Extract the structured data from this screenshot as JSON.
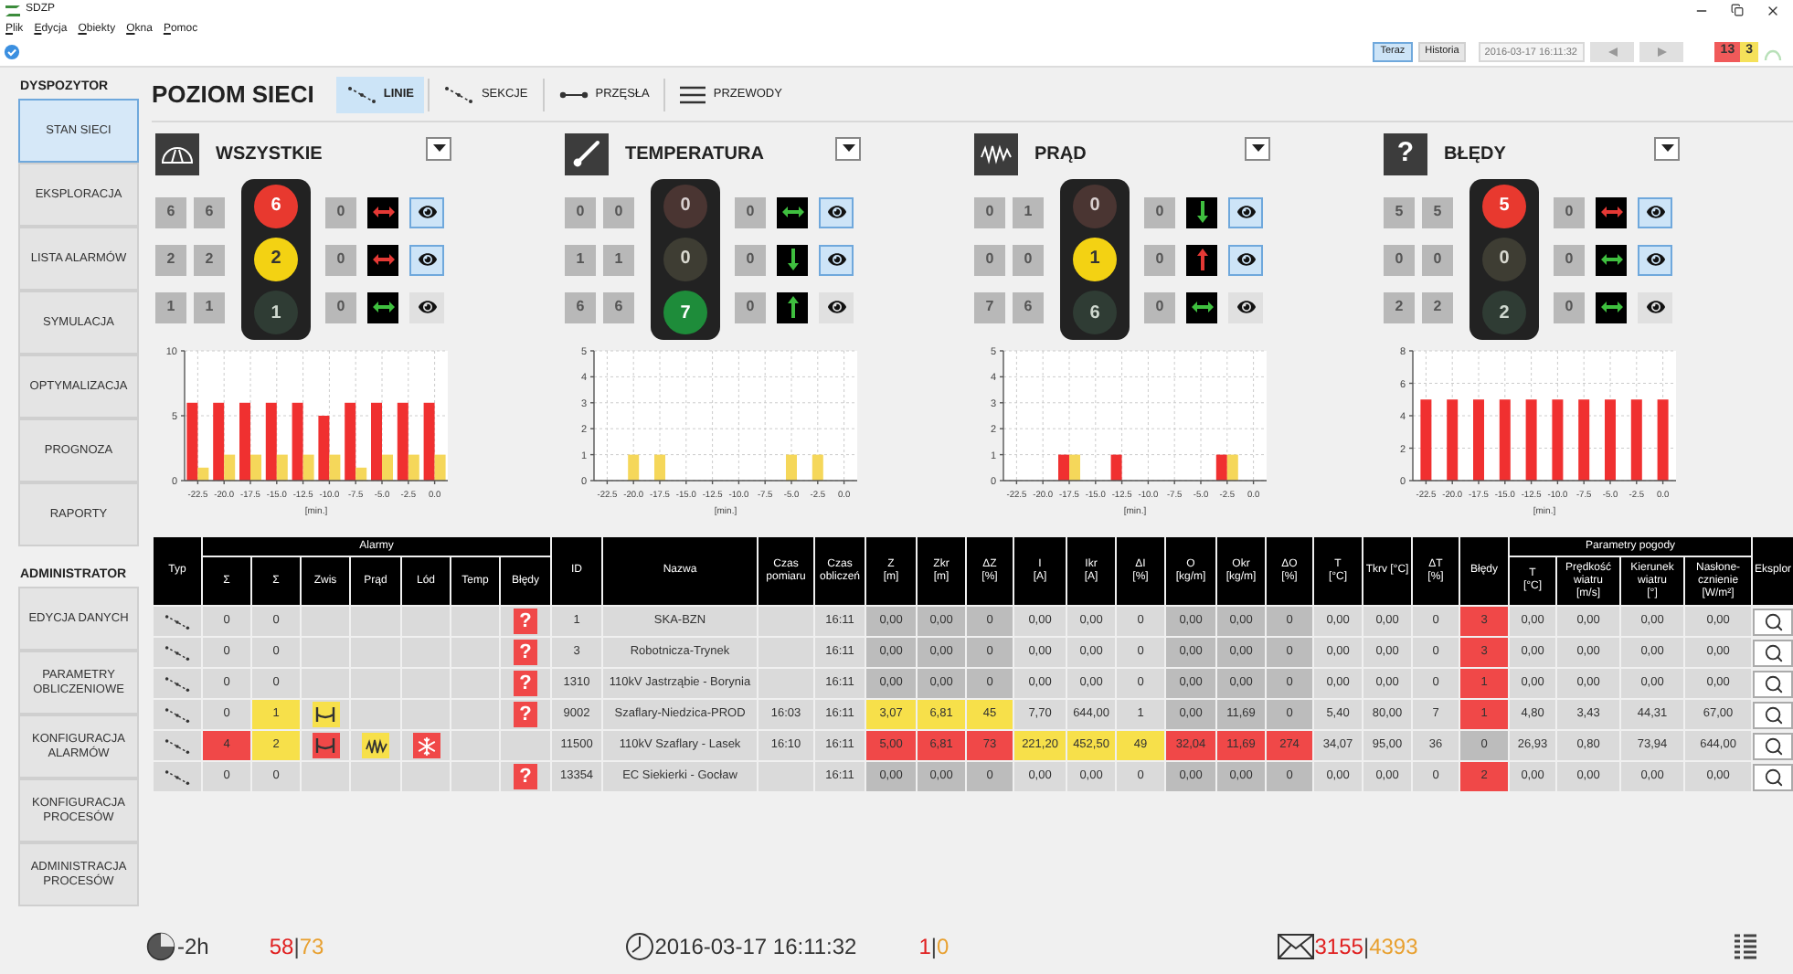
{
  "window": {
    "title": "SDZP"
  },
  "menu": [
    "Plik",
    "Edycja",
    "Obiekty",
    "Okna",
    "Pomoc"
  ],
  "toolbar": {
    "modes": [
      {
        "label": "Teraz",
        "selected": true
      },
      {
        "label": "Historia",
        "selected": false
      }
    ],
    "datetime": "2016-03-17 16:11:32",
    "counters": [
      {
        "text": "13",
        "color": "#f05a5a"
      },
      {
        "text": "3",
        "color": "#f5e15a"
      }
    ]
  },
  "sidebar": [
    {
      "title": "DYSPOZYTOR",
      "items": [
        {
          "label": "STAN SIECI",
          "selected": true
        },
        {
          "label": "EKSPLORACJA",
          "selected": false
        },
        {
          "label": "LISTA ALARMÓW",
          "selected": false
        },
        {
          "label": "SYMULACJA",
          "selected": false
        },
        {
          "label": "OPTYMALIZACJA",
          "selected": false
        },
        {
          "label": "PROGNOZA",
          "selected": false
        },
        {
          "label": "RAPORTY",
          "selected": false
        }
      ]
    },
    {
      "title": "ADMINISTRATOR",
      "items": [
        {
          "label": "EDYCJA DANYCH",
          "selected": false
        },
        {
          "label": "PARAMETRY OBLICZENIOWE",
          "selected": false
        },
        {
          "label": "KONFIGURACJA ALARMÓW",
          "selected": false
        },
        {
          "label": "KONFIGURACJA PROCESÓW",
          "selected": false
        },
        {
          "label": "ADMINISTRACJA PROCESÓW",
          "selected": false
        }
      ]
    }
  ],
  "header": {
    "title": "POZIOM SIECI",
    "tabs": [
      {
        "label": "LINIE",
        "kind": "line",
        "selected": true
      },
      {
        "label": "SEKCJE",
        "kind": "section",
        "selected": false
      },
      {
        "label": "PRZĘSŁA",
        "kind": "span",
        "selected": false
      },
      {
        "label": "PRZEWODY",
        "kind": "wire",
        "selected": false
      }
    ]
  },
  "panels": [
    {
      "kind": "gauge",
      "title": "WSZYSTKIE",
      "rows": [
        {
          "count_1": "6",
          "count_2": "6",
          "light": "6",
          "lit": true,
          "count_3": "0",
          "arrow": {
            "kind": "horizontal",
            "color": "#e53935"
          },
          "eye_selected": true
        },
        {
          "count_1": "2",
          "count_2": "2",
          "light": "2",
          "lit": true,
          "count_3": "0",
          "arrow": {
            "kind": "horizontal",
            "color": "#e53935"
          },
          "eye_selected": true
        },
        {
          "count_1": "1",
          "count_2": "1",
          "light": "1",
          "lit": false,
          "count_3": "0",
          "arrow": {
            "kind": "horizontal",
            "color": "#3fbf3f"
          },
          "eye_selected": false
        }
      ],
      "chart_data": {
        "type": "bar",
        "grid": true,
        "xlabel": "[min.]",
        "categories": [
          "-22.5",
          "-20.0",
          "-17.5",
          "-15.0",
          "-12.5",
          "-10.0",
          "-7.5",
          "-5.0",
          "-2.5",
          "0.0"
        ],
        "ylim": [
          0,
          10
        ],
        "yticks": [
          0,
          5,
          10
        ],
        "series": [
          {
            "color": "#f03030",
            "values": [
              6,
              6,
              6,
              6,
              6,
              5,
              6,
              6,
              6,
              6
            ]
          },
          {
            "color": "#f5d75a",
            "values": [
              1,
              2,
              2,
              2,
              2,
              2,
              1,
              2,
              2,
              2
            ]
          }
        ]
      }
    },
    {
      "kind": "thermometer",
      "title": "TEMPERATURA",
      "rows": [
        {
          "count_1": "0",
          "count_2": "0",
          "light": "0",
          "lit": false,
          "count_3": "0",
          "arrow": {
            "kind": "horizontal",
            "color": "#3fbf3f"
          },
          "eye_selected": true
        },
        {
          "count_1": "1",
          "count_2": "1",
          "light": "0",
          "lit": false,
          "count_3": "0",
          "arrow": {
            "kind": "down",
            "color": "#3fbf3f"
          },
          "eye_selected": true
        },
        {
          "count_1": "6",
          "count_2": "6",
          "light": "7",
          "lit": true,
          "count_3": "0",
          "arrow": {
            "kind": "up",
            "color": "#3fbf3f"
          },
          "eye_selected": false
        }
      ],
      "chart_data": {
        "type": "bar",
        "grid": true,
        "xlabel": "[min.]",
        "categories": [
          "-22.5",
          "-20.0",
          "-17.5",
          "-15.0",
          "-12.5",
          "-10.0",
          "-7.5",
          "-5.0",
          "-2.5",
          "0.0"
        ],
        "ylim": [
          0,
          5
        ],
        "yticks": [
          0,
          1,
          2,
          3,
          4,
          5
        ],
        "series": [
          {
            "color": "#f5d75a",
            "values": [
              0,
              1,
              1,
              0,
              0,
              0,
              0,
              1,
              1,
              0
            ]
          }
        ]
      }
    },
    {
      "kind": "wave",
      "title": "PRĄD",
      "rows": [
        {
          "count_1": "0",
          "count_2": "1",
          "light": "0",
          "lit": false,
          "count_3": "0",
          "arrow": {
            "kind": "down",
            "color": "#3fbf3f"
          },
          "eye_selected": true
        },
        {
          "count_1": "0",
          "count_2": "0",
          "light": "1",
          "lit": true,
          "count_3": "0",
          "arrow": {
            "kind": "up",
            "color": "#e53935"
          },
          "eye_selected": true
        },
        {
          "count_1": "7",
          "count_2": "6",
          "light": "6",
          "lit": false,
          "count_3": "0",
          "arrow": {
            "kind": "horizontal",
            "color": "#3fbf3f"
          },
          "eye_selected": false
        }
      ],
      "chart_data": {
        "type": "bar",
        "grid": true,
        "xlabel": "[min.]",
        "categories": [
          "-22.5",
          "-20.0",
          "-17.5",
          "-15.0",
          "-12.5",
          "-10.0",
          "-7.5",
          "-5.0",
          "-2.5",
          "0.0"
        ],
        "ylim": [
          0,
          5
        ],
        "yticks": [
          0,
          1,
          2,
          3,
          4,
          5
        ],
        "series": [
          {
            "color": "#f03030",
            "values": [
              0,
              0,
              1,
              0,
              1,
              0,
              0,
              0,
              1,
              0
            ]
          },
          {
            "color": "#f5d75a",
            "values": [
              0,
              0,
              1,
              0,
              0,
              0,
              0,
              0,
              1,
              0
            ]
          }
        ]
      }
    },
    {
      "kind": "errors",
      "title": "BŁĘDY",
      "icon_text": "?",
      "rows": [
        {
          "count_1": "5",
          "count_2": "5",
          "light": "5",
          "lit": true,
          "count_3": "0",
          "arrow": {
            "kind": "horizontal",
            "color": "#e53935"
          },
          "eye_selected": true
        },
        {
          "count_1": "0",
          "count_2": "0",
          "light": "0",
          "lit": false,
          "count_3": "0",
          "arrow": {
            "kind": "horizontal",
            "color": "#3fbf3f"
          },
          "eye_selected": true
        },
        {
          "count_1": "2",
          "count_2": "2",
          "light": "2",
          "lit": false,
          "count_3": "0",
          "arrow": {
            "kind": "horizontal",
            "color": "#3fbf3f"
          },
          "eye_selected": false
        }
      ],
      "chart_data": {
        "type": "bar",
        "grid": true,
        "xlabel": "[min.]",
        "categories": [
          "-22.5",
          "-20.0",
          "-17.5",
          "-15.0",
          "-12.5",
          "-10.0",
          "-7.5",
          "-5.0",
          "-2.5",
          "0.0"
        ],
        "ylim": [
          0,
          8
        ],
        "yticks": [
          0,
          2,
          4,
          6,
          8
        ],
        "series": [
          {
            "color": "#f03030",
            "values": [
              5,
              5,
              5,
              5,
              5,
              5,
              5,
              5,
              5,
              5
            ]
          }
        ]
      }
    }
  ],
  "table": {
    "column_groups": [
      {
        "label": "Alarmy"
      },
      {
        "label": "Parametry pogody"
      }
    ],
    "columns": [
      {
        "label": "Typ",
        "grouped": false
      },
      {
        "label": "Σ",
        "grouped": true
      },
      {
        "label": "Σ",
        "grouped": true
      },
      {
        "label": "Zwis",
        "grouped": true
      },
      {
        "label": "Prąd",
        "grouped": true
      },
      {
        "label": "Lód",
        "grouped": true
      },
      {
        "label": "Temp",
        "grouped": true
      },
      {
        "label": "Błędy",
        "grouped": true
      },
      {
        "label": "ID",
        "grouped": false
      },
      {
        "label": "Nazwa",
        "grouped": false
      },
      {
        "label": "Czas pomiaru",
        "grouped": false
      },
      {
        "label": "Czas obliczeń",
        "grouped": false
      },
      {
        "label": "Z",
        "unit": "[m]",
        "grouped": false
      },
      {
        "label": "Zkr",
        "unit": "[m]",
        "grouped": false
      },
      {
        "label": "ΔZ",
        "unit": "[%]",
        "grouped": false
      },
      {
        "label": "I",
        "unit": "[A]",
        "grouped": false
      },
      {
        "label": "Ikr",
        "unit": "[A]",
        "grouped": false
      },
      {
        "label": "ΔI",
        "unit": "[%]",
        "grouped": false
      },
      {
        "label": "O",
        "unit": "[kg/m]",
        "grouped": false
      },
      {
        "label": "Okr",
        "unit": "[kg/m]",
        "grouped": false
      },
      {
        "label": "ΔO",
        "unit": "[%]",
        "grouped": false
      },
      {
        "label": "T",
        "unit": "[°C]",
        "grouped": false
      },
      {
        "label": "Tkrv [°C]",
        "grouped": false
      },
      {
        "label": "ΔT",
        "unit": "[%]",
        "grouped": false
      },
      {
        "label": "Błędy",
        "grouped": false
      },
      {
        "label": "T",
        "unit": "[°C]",
        "grouped": true
      },
      {
        "label": "Prędkość wiatru",
        "unit": "[m/s]",
        "grouped": true
      },
      {
        "label": "Kierunek wiatru",
        "unit": "[°]",
        "grouped": true
      },
      {
        "label": "Nasłone- cznienie",
        "unit": "[W/m²]",
        "grouped": true
      },
      {
        "label": "Eksplor",
        "grouped": false
      }
    ],
    "rows": [
      {
        "cells": [
          {
            "kind": "line"
          },
          {
            "text": "0"
          },
          {
            "text": "0"
          },
          {},
          {},
          {},
          {},
          {
            "kind": "error",
            "text": "?",
            "color": "#f04848"
          },
          {
            "text": "1"
          },
          {
            "text": "SKA-BZN"
          },
          {},
          {
            "text": "16:11"
          },
          {
            "text": "0,00",
            "color": "#bcbcbc"
          },
          {
            "text": "0,00",
            "color": "#bcbcbc"
          },
          {
            "text": "0",
            "color": "#bcbcbc"
          },
          {
            "text": "0,00"
          },
          {
            "text": "0,00"
          },
          {
            "text": "0"
          },
          {
            "text": "0,00",
            "color": "#bcbcbc"
          },
          {
            "text": "0,00",
            "color": "#bcbcbc"
          },
          {
            "text": "0",
            "color": "#bcbcbc"
          },
          {
            "text": "0,00"
          },
          {
            "text": "0,00"
          },
          {
            "text": "0"
          },
          {
            "text": "3",
            "color": "#f04848"
          },
          {
            "text": "0,00"
          },
          {
            "text": "0,00"
          },
          {
            "text": "0,00"
          },
          {
            "text": "0,00"
          },
          {
            "kind": "action"
          }
        ]
      },
      {
        "cells": [
          {
            "kind": "line"
          },
          {
            "text": "0"
          },
          {
            "text": "0"
          },
          {},
          {},
          {},
          {},
          {
            "kind": "error",
            "text": "?",
            "color": "#f04848"
          },
          {
            "text": "3"
          },
          {
            "text": "Robotnicza-Trynek"
          },
          {},
          {
            "text": "16:11"
          },
          {
            "text": "0,00",
            "color": "#bcbcbc"
          },
          {
            "text": "0,00",
            "color": "#bcbcbc"
          },
          {
            "text": "0",
            "color": "#bcbcbc"
          },
          {
            "text": "0,00"
          },
          {
            "text": "0,00"
          },
          {
            "text": "0"
          },
          {
            "text": "0,00",
            "color": "#bcbcbc"
          },
          {
            "text": "0,00",
            "color": "#bcbcbc"
          },
          {
            "text": "0",
            "color": "#bcbcbc"
          },
          {
            "text": "0,00"
          },
          {
            "text": "0,00"
          },
          {
            "text": "0"
          },
          {
            "text": "3",
            "color": "#f04848"
          },
          {
            "text": "0,00"
          },
          {
            "text": "0,00"
          },
          {
            "text": "0,00"
          },
          {
            "text": "0,00"
          },
          {
            "kind": "action"
          }
        ]
      },
      {
        "cells": [
          {
            "kind": "line"
          },
          {
            "text": "0"
          },
          {
            "text": "0"
          },
          {},
          {},
          {},
          {},
          {
            "kind": "error",
            "text": "?",
            "color": "#f04848"
          },
          {
            "text": "1310"
          },
          {
            "text": "110kV Jastrząbie - Borynia"
          },
          {},
          {
            "text": "16:11"
          },
          {
            "text": "0,00",
            "color": "#bcbcbc"
          },
          {
            "text": "0,00",
            "color": "#bcbcbc"
          },
          {
            "text": "0",
            "color": "#bcbcbc"
          },
          {
            "text": "0,00"
          },
          {
            "text": "0,00"
          },
          {
            "text": "0"
          },
          {
            "text": "0,00",
            "color": "#bcbcbc"
          },
          {
            "text": "0,00",
            "color": "#bcbcbc"
          },
          {
            "text": "0",
            "color": "#bcbcbc"
          },
          {
            "text": "0,00"
          },
          {
            "text": "0,00"
          },
          {
            "text": "0"
          },
          {
            "text": "1",
            "color": "#f04848"
          },
          {
            "text": "0,00"
          },
          {
            "text": "0,00"
          },
          {
            "text": "0,00"
          },
          {
            "text": "0,00"
          },
          {
            "kind": "action"
          }
        ]
      },
      {
        "cells": [
          {
            "kind": "line"
          },
          {
            "text": "0"
          },
          {
            "text": "1",
            "color": "#f7e04a"
          },
          {
            "kind": "sag",
            "color": "#f7e04a"
          },
          {},
          {},
          {},
          {
            "kind": "error",
            "text": "?",
            "color": "#f04848"
          },
          {
            "text": "9002"
          },
          {
            "text": "Szaflary-Niedzica-PROD"
          },
          {
            "text": "16:03"
          },
          {
            "text": "16:11"
          },
          {
            "text": "3,07",
            "color": "#f7e04a"
          },
          {
            "text": "6,81",
            "color": "#f7e04a"
          },
          {
            "text": "45",
            "color": "#f7e04a"
          },
          {
            "text": "7,70"
          },
          {
            "text": "644,00"
          },
          {
            "text": "1"
          },
          {
            "text": "0,00",
            "color": "#bcbcbc"
          },
          {
            "text": "11,69",
            "color": "#bcbcbc"
          },
          {
            "text": "0",
            "color": "#bcbcbc"
          },
          {
            "text": "5,40"
          },
          {
            "text": "80,00"
          },
          {
            "text": "7"
          },
          {
            "text": "1",
            "color": "#f04848"
          },
          {
            "text": "4,80"
          },
          {
            "text": "3,43"
          },
          {
            "text": "44,31"
          },
          {
            "text": "67,00"
          },
          {
            "kind": "action"
          }
        ]
      },
      {
        "cells": [
          {
            "kind": "line"
          },
          {
            "text": "4",
            "color": "#f04848"
          },
          {
            "text": "2",
            "color": "#f7e04a"
          },
          {
            "kind": "sag",
            "color": "#f04848"
          },
          {
            "kind": "current",
            "color": "#f7e04a"
          },
          {
            "kind": "ice",
            "color": "#f04848"
          },
          {},
          {},
          {
            "text": "11500"
          },
          {
            "text": "110kV Szaflary - Lasek"
          },
          {
            "text": "16:10"
          },
          {
            "text": "16:11"
          },
          {
            "text": "5,00",
            "color": "#f04848"
          },
          {
            "text": "6,81",
            "color": "#f04848"
          },
          {
            "text": "73",
            "color": "#f04848"
          },
          {
            "text": "221,20",
            "color": "#f7e04a"
          },
          {
            "text": "452,50",
            "color": "#f7e04a"
          },
          {
            "text": "49",
            "color": "#f7e04a"
          },
          {
            "text": "32,04",
            "color": "#f04848"
          },
          {
            "text": "11,69",
            "color": "#f04848"
          },
          {
            "text": "274",
            "color": "#f04848"
          },
          {
            "text": "34,07"
          },
          {
            "text": "95,00"
          },
          {
            "text": "36"
          },
          {
            "text": "0",
            "color": "#bcbcbc"
          },
          {
            "text": "26,93"
          },
          {
            "text": "0,80"
          },
          {
            "text": "73,94"
          },
          {
            "text": "644,00"
          },
          {
            "kind": "action"
          }
        ]
      },
      {
        "cells": [
          {
            "kind": "line"
          },
          {
            "text": "0"
          },
          {
            "text": "0"
          },
          {},
          {},
          {},
          {},
          {
            "kind": "error",
            "text": "?",
            "color": "#f04848"
          },
          {
            "text": "13354"
          },
          {
            "text": "EC Siekierki - Gocław"
          },
          {},
          {
            "text": "16:11"
          },
          {
            "text": "0,00",
            "color": "#bcbcbc"
          },
          {
            "text": "0,00",
            "color": "#bcbcbc"
          },
          {
            "text": "0",
            "color": "#bcbcbc"
          },
          {
            "text": "0,00"
          },
          {
            "text": "0,00"
          },
          {
            "text": "0"
          },
          {
            "text": "0,00",
            "color": "#bcbcbc"
          },
          {
            "text": "0,00",
            "color": "#bcbcbc"
          },
          {
            "text": "0",
            "color": "#bcbcbc"
          },
          {
            "text": "0,00"
          },
          {
            "text": "0,00"
          },
          {
            "text": "0"
          },
          {
            "text": "2",
            "color": "#f04848"
          },
          {
            "text": "0,00"
          },
          {
            "text": "0,00"
          },
          {
            "text": "0,00"
          },
          {
            "text": "0,00"
          },
          {
            "kind": "action"
          }
        ]
      }
    ]
  },
  "status_bar": {
    "range": "-2h",
    "range_counts": [
      {
        "text": "58",
        "color": "#e02020"
      },
      {
        "text": "|",
        "color": "#444444"
      },
      {
        "text": "73",
        "color": "#e8a030"
      }
    ],
    "time": "2016-03-17 16:11:32",
    "time_counts": [
      {
        "text": "1",
        "color": "#e02020"
      },
      {
        "text": "|",
        "color": "#444444"
      },
      {
        "text": "0",
        "color": "#e8a030"
      }
    ],
    "message_counts": [
      {
        "text": "3155",
        "color": "#e02020"
      },
      {
        "text": "|",
        "color": "#444444"
      },
      {
        "text": "4393",
        "color": "#e8a030"
      }
    ]
  }
}
